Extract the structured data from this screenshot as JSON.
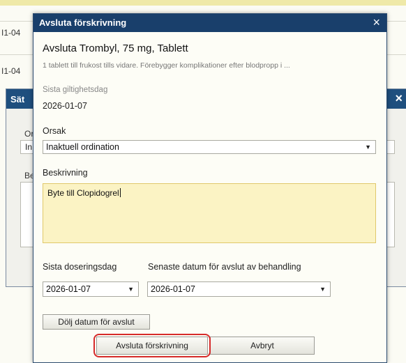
{
  "background": {
    "row_labels": [
      "I1-04",
      "I1-04"
    ],
    "dialog_title": "Sät",
    "label_o": "Or",
    "field_in": "In",
    "label_be": "Be"
  },
  "modal": {
    "title": "Avsluta förskrivning",
    "close_icon": "×",
    "heading": "Avsluta Trombyl, 75 mg, Tablett",
    "dosage_text": "1 tablett till frukost tills vidare. Förebygger komplikationer efter blodpropp i ...",
    "last_valid_label": "Sista giltighetsdag",
    "last_valid_value": "2026-01-07",
    "reason_label": "Orsak",
    "reason_value": "Inaktuell ordination",
    "description_label": "Beskrivning",
    "description_value": "Byte till Clopidogrel",
    "last_dose_label": "Sista doseringsdag",
    "last_dose_value": "2026-01-07",
    "latest_end_label": "Senaste datum för avslut av behandling",
    "latest_end_value": "2026-01-07",
    "hide_dates_button": "Dölj datum för avslut",
    "end_prescription_button": "Avsluta förskrivning",
    "cancel_button": "Avbryt"
  },
  "colors": {
    "titlebar": "#193f6b",
    "textarea_bg": "#fbf3c4",
    "highlight": "#d62a2a"
  }
}
